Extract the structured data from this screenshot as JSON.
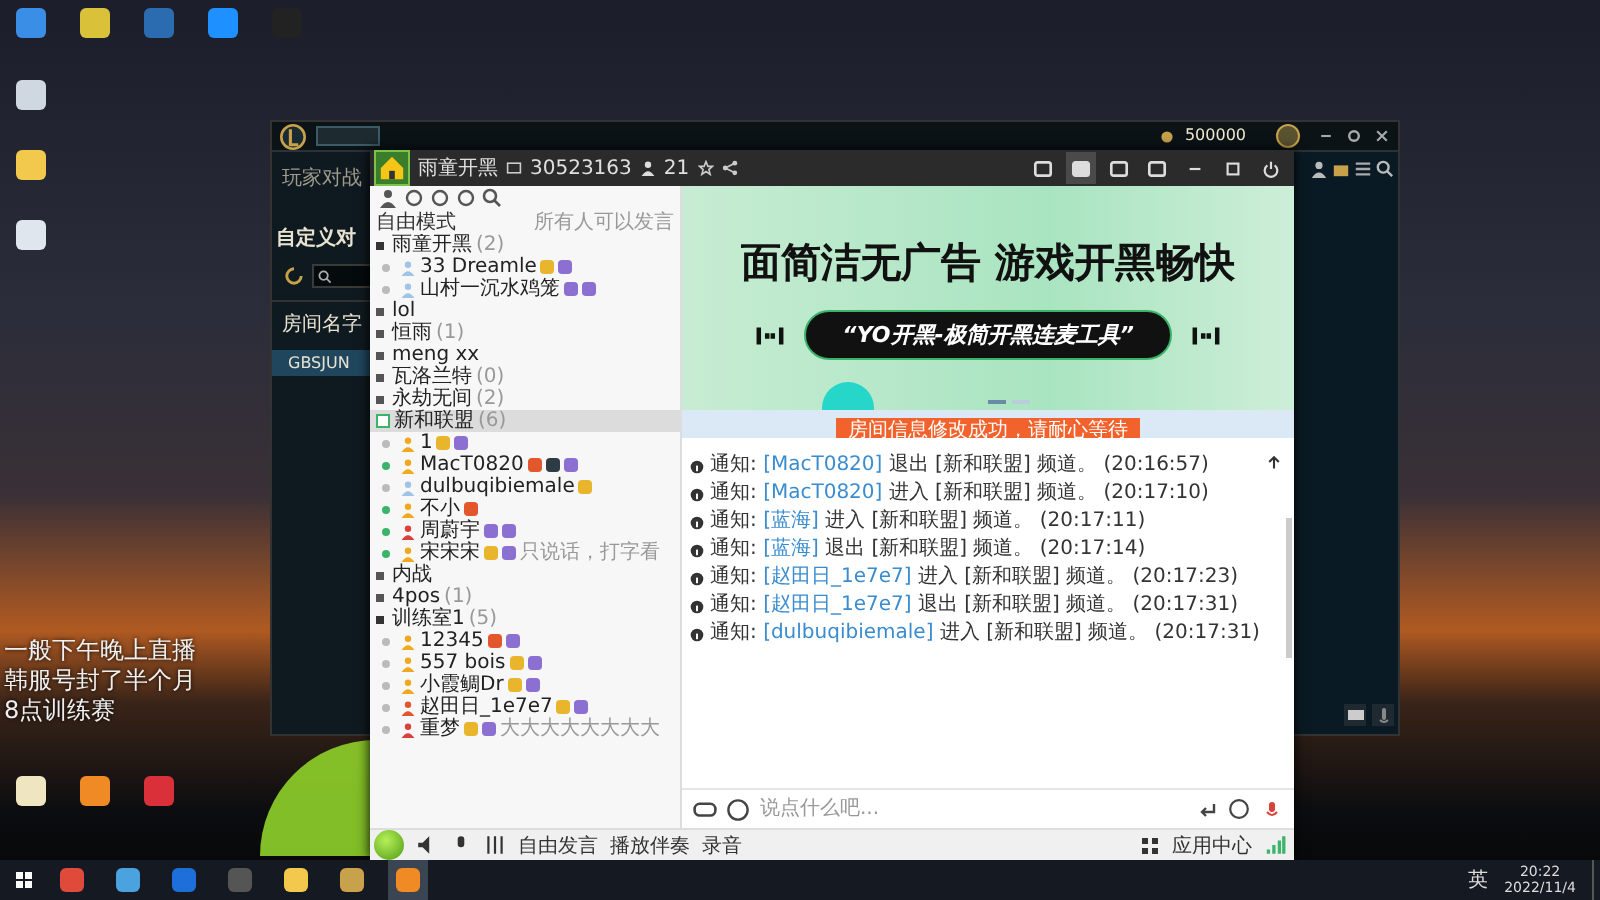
{
  "desktop": {
    "note_lines": [
      "一般下午晚上直播",
      "韩服号封了半个月",
      "8点训练赛"
    ]
  },
  "game_client": {
    "nav_tab": "玩家对战",
    "heading": "自定义对",
    "column_header": "房间名字",
    "room_row": {
      "name": "GBSJUN",
      "selected": true
    },
    "currency": "500000"
  },
  "voice_app": {
    "title": {
      "channel_name": "雨童开黑",
      "channel_id": "30523163",
      "online_count": "21"
    },
    "mode": "自由模式",
    "mode_note": "所有人可以发言",
    "tree": [
      {
        "name": "雨童开黑",
        "count": "(2)",
        "expanded": true,
        "selected": false,
        "children": [
          {
            "name": "33 Dreamle",
            "color": "#9fc4e8",
            "online": false,
            "badges": [
              {
                "color": "#e8b52c"
              },
              {
                "color": "#8b6fd1"
              }
            ]
          },
          {
            "name": "山村一沉水鸡笼",
            "color": "#9fc4e8",
            "online": false,
            "badges": [
              {
                "color": "#8b6fd1"
              },
              {
                "color": "#8b6fd1"
              }
            ]
          }
        ]
      },
      {
        "name": "lol",
        "expanded": false,
        "selected": false
      },
      {
        "name": "恒雨",
        "count": "(1)",
        "expanded": false,
        "selected": false
      },
      {
        "name": "meng xx",
        "expanded": false,
        "selected": false
      },
      {
        "name": "瓦洛兰特",
        "count": "(0)",
        "expanded": false,
        "selected": false
      },
      {
        "name": "永劫无间",
        "count": "(2)",
        "expanded": false,
        "selected": false
      },
      {
        "name": "新和联盟",
        "count": "(6)",
        "expanded": true,
        "selected": true,
        "children": [
          {
            "name": "1",
            "color": "#f0a81c",
            "online": false,
            "badges": [
              {
                "color": "#e8b52c"
              },
              {
                "color": "#8b6fd1"
              }
            ]
          },
          {
            "name": "MacT0820",
            "color": "#f0a81c",
            "online": true,
            "badges": [
              {
                "color": "#e2572b"
              },
              {
                "color": "#2d3b45"
              },
              {
                "color": "#8b6fd1"
              }
            ]
          },
          {
            "name": "dulbuqibiemale",
            "color": "#9fc4e8",
            "online": false,
            "badges": [
              {
                "color": "#e8b52c"
              }
            ]
          },
          {
            "name": "不小",
            "color": "#f0a81c",
            "online": true,
            "badges": [
              {
                "color": "#e2572b"
              }
            ]
          },
          {
            "name": "周蔚宇",
            "color": "#d9413a",
            "online": true,
            "badges": [
              {
                "color": "#8b6fd1"
              },
              {
                "color": "#8b6fd1"
              }
            ]
          },
          {
            "name": "宋宋宋",
            "color": "#f0a81c",
            "online": true,
            "badges": [
              {
                "color": "#e8b52c"
              },
              {
                "color": "#8b6fd1"
              }
            ],
            "note": "只说话，打字看"
          }
        ]
      },
      {
        "name": "内战",
        "expanded": false,
        "selected": false
      },
      {
        "name": "4pos",
        "count": "(1)",
        "expanded": false,
        "selected": false
      },
      {
        "name": "训练室1",
        "count": "(5)",
        "expanded": true,
        "selected": false,
        "children": [
          {
            "name": "12345",
            "color": "#f0a81c",
            "online": false,
            "badges": [
              {
                "color": "#e2572b"
              },
              {
                "color": "#8b6fd1"
              }
            ]
          },
          {
            "name": "557 bois",
            "color": "#f0a81c",
            "online": false,
            "badges": [
              {
                "color": "#e8b52c"
              },
              {
                "color": "#8b6fd1"
              }
            ]
          },
          {
            "name": "小霞鲷Dr",
            "color": "#f0a81c",
            "online": false,
            "badges": [
              {
                "color": "#e8b52c"
              },
              {
                "color": "#8b6fd1"
              }
            ]
          },
          {
            "name": "赵田日_1e7e7",
            "color": "#e2572b",
            "online": false,
            "badges": [
              {
                "color": "#e8b52c"
              },
              {
                "color": "#8b6fd1"
              }
            ]
          },
          {
            "name": "重梦",
            "color": "#d9413a",
            "online": false,
            "badges": [
              {
                "color": "#e8b52c"
              },
              {
                "color": "#8b6fd1"
              }
            ],
            "note": "大大大大大大大大"
          }
        ]
      }
    ],
    "banner": {
      "headline": "面简洁无广告  游戏开黑畅快",
      "slogan": "“YO开黑-极简开黑连麦工具”",
      "slides": [
        {
          "selected": true
        },
        {
          "selected": false
        }
      ]
    },
    "toast": "房间信息修改成功，请耐心等待",
    "messages": [
      {
        "label": "通知:",
        "user": "[MacT0820]",
        "action": "退出",
        "channel": "[新和联盟]",
        "suffix": "频道。",
        "time": "(20:16:57)"
      },
      {
        "label": "通知:",
        "user": "[MacT0820]",
        "action": "进入",
        "channel": "[新和联盟]",
        "suffix": "频道。",
        "time": "(20:17:10)"
      },
      {
        "label": "通知:",
        "user": "[蓝海]",
        "action": "进入",
        "channel": "[新和联盟]",
        "suffix": "频道。",
        "time": "(20:17:11)"
      },
      {
        "label": "通知:",
        "user": "[蓝海]",
        "action": "退出",
        "channel": "[新和联盟]",
        "suffix": "频道。",
        "time": "(20:17:14)"
      },
      {
        "label": "通知:",
        "user": "[赵田日_1e7e7]",
        "action": "进入",
        "channel": "[新和联盟]",
        "suffix": "频道。",
        "time": "(20:17:23)"
      },
      {
        "label": "通知:",
        "user": "[赵田日_1e7e7]",
        "action": "退出",
        "channel": "[新和联盟]",
        "suffix": "频道。",
        "time": "(20:17:31)"
      },
      {
        "label": "通知:",
        "user": "[dulbuqibiemale]",
        "action": "进入",
        "channel": "[新和联盟]",
        "suffix": "频道。",
        "time": "(20:17:31)"
      }
    ],
    "input": {
      "placeholder": "说点什么吧..."
    },
    "bottom_bar": {
      "speak_mode": "自由发言",
      "accompaniment": "播放伴奏",
      "record": "录音",
      "app_center": "应用中心"
    }
  },
  "taskbar": {
    "input_method": "英",
    "time": "20:22",
    "date": "2022/11/4"
  }
}
